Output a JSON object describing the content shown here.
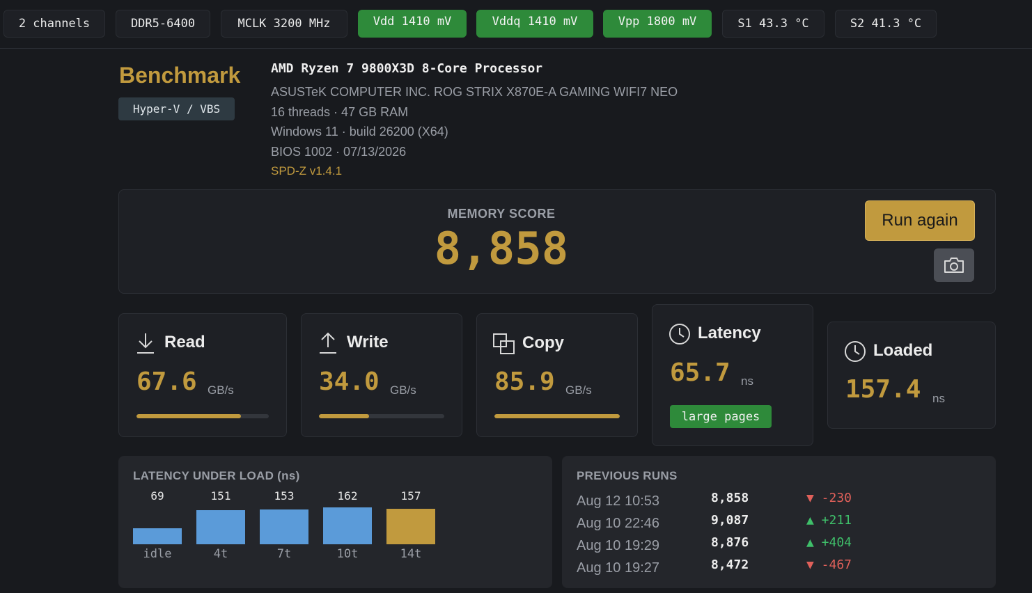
{
  "status_bar": {
    "chips": [
      {
        "label": "2 channels",
        "type": "normal"
      },
      {
        "label": "DDR5-6400",
        "type": "normal"
      },
      {
        "label": "MCLK 3200 MHz",
        "type": "normal"
      },
      {
        "label": "Vdd 1410 mV",
        "type": "ok"
      },
      {
        "label": "Vddq 1410 mV",
        "type": "ok"
      },
      {
        "label": "Vpp 1800 mV",
        "type": "ok"
      },
      {
        "label": "S1 43.3 °C",
        "type": "normal"
      },
      {
        "label": "S2 41.3 °C",
        "type": "normal"
      }
    ]
  },
  "header": {
    "title": "Benchmark",
    "badge": "Hyper-V / VBS",
    "cpu": "AMD Ryzen 7 9800X3D 8-Core Processor",
    "board": "ASUSTeK COMPUTER INC. ROG STRIX X870E-A GAMING WIFI7 NEO",
    "threads_ram": "16 threads · 47 GB RAM",
    "os": "Windows 11 · build 26200 (X64)",
    "bios": "BIOS 1002 · 07/13/2026",
    "version": "SPD-Z v1.4.1"
  },
  "score": {
    "label": "MEMORY SCORE",
    "value": "8,858",
    "run_again_label": "Run again",
    "snapshot_icon": "camera-icon"
  },
  "metrics": {
    "read": {
      "title": "Read",
      "value": "67.6",
      "unit": "GB/s",
      "fill_pct": 79,
      "icon": "download-icon"
    },
    "write": {
      "title": "Write",
      "value": "34.0",
      "unit": "GB/s",
      "fill_pct": 40,
      "icon": "upload-icon"
    },
    "copy": {
      "title": "Copy",
      "value": "85.9",
      "unit": "GB/s",
      "fill_pct": 100,
      "icon": "copy-icon"
    },
    "latency": {
      "title": "Latency",
      "value": "65.7",
      "unit": "ns",
      "badge": "large pages",
      "icon": "clock-icon"
    },
    "loaded": {
      "title": "Loaded",
      "value": "157.4",
      "unit": "ns",
      "icon": "clock-icon"
    }
  },
  "latency_under_load": {
    "title": "LATENCY UNDER LOAD (ns)",
    "bars": [
      {
        "label": "idle",
        "value": 69,
        "display": "69",
        "highlight": false
      },
      {
        "label": "4t",
        "value": 151,
        "display": "151",
        "highlight": false
      },
      {
        "label": "7t",
        "value": 153,
        "display": "153",
        "highlight": false
      },
      {
        "label": "10t",
        "value": 162,
        "display": "162",
        "highlight": false
      },
      {
        "label": "14t",
        "value": 157,
        "display": "157",
        "highlight": true
      }
    ],
    "colors": {
      "normal": "#5b9bd9",
      "highlight": "#c19a3e"
    }
  },
  "previous_runs": {
    "title": "PREVIOUS RUNS",
    "rows": [
      {
        "time": "Aug 12 10:53",
        "score": "8,858",
        "delta": "▼ -230",
        "dir": "down"
      },
      {
        "time": "Aug 10 22:46",
        "score": "9,087",
        "delta": "▲ +211",
        "dir": "up"
      },
      {
        "time": "Aug 10 19:29",
        "score": "8,876",
        "delta": "▲ +404",
        "dir": "up"
      },
      {
        "time": "Aug 10 19:27",
        "score": "8,472",
        "delta": "▼ -467",
        "dir": "down"
      }
    ]
  },
  "colors": {
    "accent": "#c19a3e",
    "ok": "#2e8a3a",
    "bg": "#181a1e",
    "up": "#3fbf6a",
    "down": "#e0605a"
  }
}
